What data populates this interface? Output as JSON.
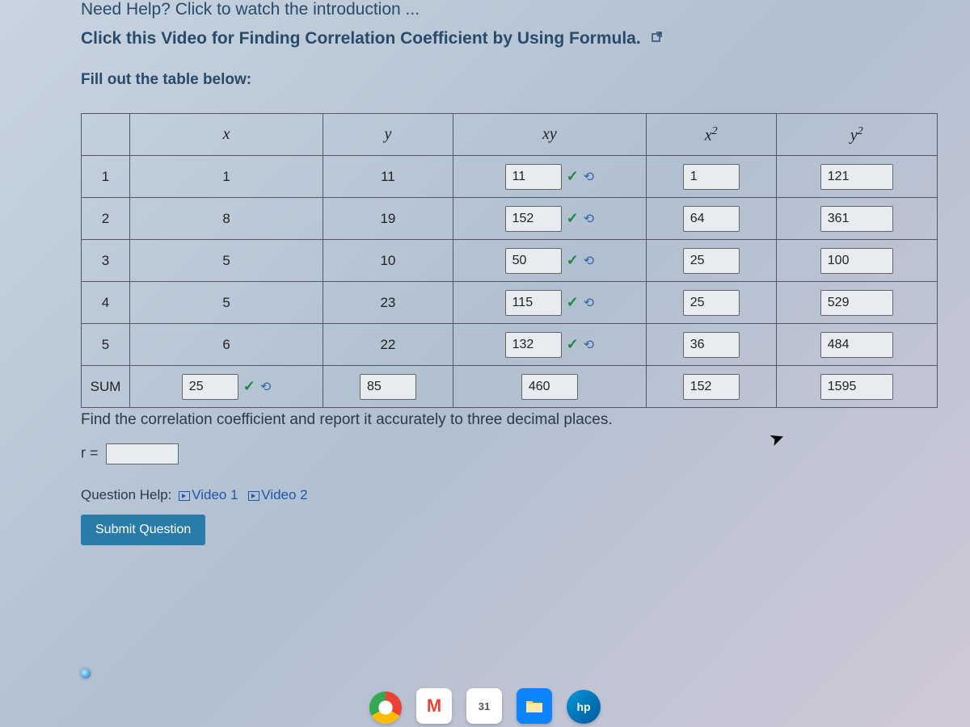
{
  "heading": {
    "need_help": "Need Help? Click to watch the introduction ...",
    "video_link": "Click this Video for Finding Correlation Coefficient by Using Formula.",
    "fill_label": "Fill out the table below:"
  },
  "table": {
    "headers": [
      "",
      "x",
      "y",
      "xy",
      "x²",
      "y²"
    ],
    "rows": [
      {
        "n": "1",
        "x": "1",
        "y": "11",
        "xy": "11",
        "xy_check": true,
        "x2": "1",
        "y2": "121"
      },
      {
        "n": "2",
        "x": "8",
        "y": "19",
        "xy": "152",
        "xy_check": true,
        "x2": "64",
        "y2": "361"
      },
      {
        "n": "3",
        "x": "5",
        "y": "10",
        "xy": "50",
        "xy_check": true,
        "x2": "25",
        "y2": "100"
      },
      {
        "n": "4",
        "x": "5",
        "y": "23",
        "xy": "115",
        "xy_check": true,
        "x2": "25",
        "y2": "529"
      },
      {
        "n": "5",
        "x": "6",
        "y": "22",
        "xy": "132",
        "xy_check": true,
        "x2": "36",
        "y2": "484"
      }
    ],
    "sum": {
      "label": "SUM",
      "x": "25",
      "x_check": true,
      "y": "85",
      "xy": "460",
      "x2": "152",
      "y2": "1595"
    }
  },
  "instruct": "Find the correlation coefficient and report it accurately to three decimal places.",
  "r_label": "r =",
  "qhelp": {
    "label": "Question Help:",
    "v1": "Video 1",
    "v2": "Video 2"
  },
  "submit": "Submit Question",
  "taskbar": {
    "gmail": "M",
    "cal": "31",
    "hp": "hp"
  }
}
